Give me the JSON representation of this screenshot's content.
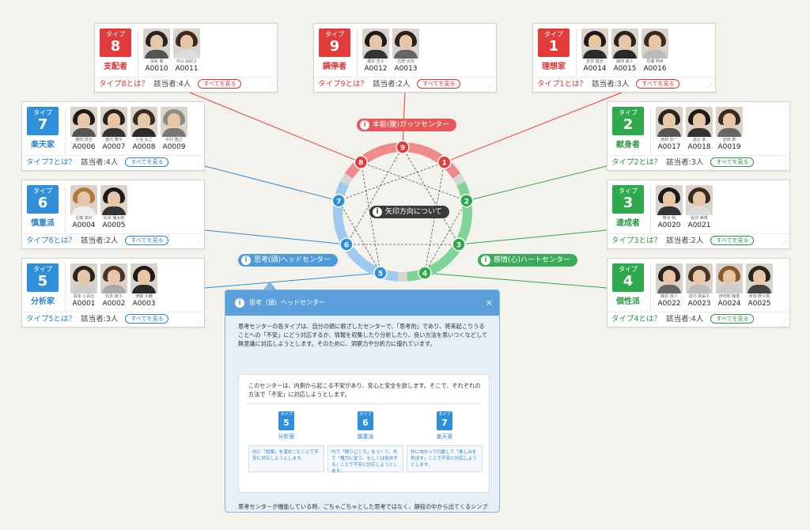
{
  "cards": [
    {
      "id": "t8",
      "type": "タイプ",
      "num": "8",
      "name": "支配者",
      "color": "red",
      "q": "タイプ8とは？",
      "count": "該当者:4人",
      "see": "すべてを見る",
      "members": [
        {
          "name": "深坂 徹",
          "code": "A0010",
          "hair": "#2a2420",
          "shirt": "#555"
        },
        {
          "name": "中山 由紀子",
          "code": "A0011",
          "hair": "#3a2a20",
          "shirt": "#ddd"
        }
      ]
    },
    {
      "id": "t9",
      "type": "タイプ",
      "num": "9",
      "name": "調停者",
      "color": "red",
      "q": "タイプ9とは？",
      "count": "該当者:2人",
      "see": "すべてを見る",
      "members": [
        {
          "name": "橋本 吉子",
          "code": "A0012",
          "hair": "#1e1a18",
          "shirt": "#333"
        },
        {
          "name": "古野 大地",
          "code": "A0013",
          "hair": "#2a221c",
          "shirt": "#666"
        }
      ]
    },
    {
      "id": "t1",
      "type": "タイプ",
      "num": "1",
      "name": "理想家",
      "color": "red",
      "q": "タイプ1とは？",
      "count": "該当者:3人",
      "see": "すべてを見る",
      "members": [
        {
          "name": "岩本 健史",
          "code": "A0014",
          "hair": "#1e1a18",
          "shirt": "#2a2a2a"
        },
        {
          "name": "藤田 夏人",
          "code": "A0015",
          "hair": "#2a221c",
          "shirt": "#2a2a2a"
        },
        {
          "name": "早瀬 明世",
          "code": "A0016",
          "hair": "#3a2a20",
          "shirt": "#bbb"
        }
      ]
    },
    {
      "id": "t7",
      "type": "タイプ",
      "num": "7",
      "name": "楽天家",
      "color": "blue",
      "q": "タイプ7とは？",
      "count": "該当者:4人",
      "see": "すべてを見る",
      "members": [
        {
          "name": "横田 祥正",
          "code": "A0006",
          "hair": "#1e1a18",
          "shirt": "#555"
        },
        {
          "name": "春元 舞平",
          "code": "A0007",
          "hair": "#2a221c",
          "shirt": "#333"
        },
        {
          "name": "小島 弘之",
          "code": "A0008",
          "hair": "#3a2a20",
          "shirt": "#2a2a2a"
        },
        {
          "name": "中村 隆之",
          "code": "A0009",
          "hair": "#8a8a86",
          "shirt": "#777"
        }
      ]
    },
    {
      "id": "t6",
      "type": "タイプ",
      "num": "6",
      "name": "慎重派",
      "color": "blue",
      "q": "タイプ6とは？",
      "count": "該当者:2人",
      "see": "すべてを見る",
      "members": [
        {
          "name": "近藤 真紗",
          "code": "A0004",
          "hair": "#b07a3a",
          "shirt": "#eee"
        },
        {
          "name": "矢澤 優太郎",
          "code": "A0005",
          "hair": "#1e1a18",
          "shirt": "#333"
        }
      ]
    },
    {
      "id": "t5",
      "type": "タイプ",
      "num": "5",
      "name": "分析家",
      "color": "blue",
      "q": "タイプ5とは？",
      "count": "該当者:3人",
      "see": "すべてを見る",
      "members": [
        {
          "name": "岡本 小百合",
          "code": "A0001",
          "hair": "#2a2420",
          "shirt": "#ccc"
        },
        {
          "name": "松本 綾子",
          "code": "A0002",
          "hair": "#4a3424",
          "shirt": "#aaa"
        },
        {
          "name": "伊藤 大輔",
          "code": "A0003",
          "hair": "#1e1a18",
          "shirt": "#2a2a2a"
        }
      ]
    },
    {
      "id": "t2",
      "type": "タイプ",
      "num": "2",
      "name": "献身者",
      "color": "green",
      "q": "タイプ2とは？",
      "count": "該当者:3人",
      "see": "すべてを見る",
      "members": [
        {
          "name": "西林 旧一",
          "code": "A0017",
          "hair": "#2a2420",
          "shirt": "#555"
        },
        {
          "name": "濱辻 孝",
          "code": "A0018",
          "hair": "#1e1a18",
          "shirt": "#333"
        },
        {
          "name": "前田 貫",
          "code": "A0019",
          "hair": "#3a2a20",
          "shirt": "#666"
        }
      ]
    },
    {
      "id": "t3",
      "type": "タイプ",
      "num": "3",
      "name": "達成者",
      "color": "green",
      "q": "タイプ3とは？",
      "count": "該当者:2人",
      "see": "すべてを見る",
      "members": [
        {
          "name": "櫻木 和",
          "code": "A0020",
          "hair": "#1e1a18",
          "shirt": "#333"
        },
        {
          "name": "長井 美菜",
          "code": "A0021",
          "hair": "#3a2a20",
          "shirt": "#ddd"
        }
      ]
    },
    {
      "id": "t4",
      "type": "タイプ",
      "num": "4",
      "name": "個性派",
      "color": "green",
      "q": "タイプ4とは？",
      "count": "該当者:4人",
      "see": "すべてを見る",
      "members": [
        {
          "name": "藤井 良介",
          "code": "A0022",
          "hair": "#2a2420",
          "shirt": "#666"
        },
        {
          "name": "成内 真由子",
          "code": "A0023",
          "hair": "#4a3424",
          "shirt": "#bbb"
        },
        {
          "name": "伊地知 静香",
          "code": "A0024",
          "hair": "#8a5a2a",
          "shirt": "#ccc"
        },
        {
          "name": "世田 野々香",
          "code": "A0025",
          "hair": "#2a2420",
          "shirt": "#444"
        }
      ]
    }
  ],
  "center_labels": {
    "gut": "本能(腹)ガッツセンター",
    "heart": "感情(心)ハートセンター",
    "head": "思考(頭)ヘッドセンター",
    "arrow": "矢印方向について",
    "info_icon": "i"
  },
  "nodes": [
    {
      "num": "9",
      "color": "#e23b3b"
    },
    {
      "num": "1",
      "color": "#e23b3b"
    },
    {
      "num": "2",
      "color": "#2ea94c"
    },
    {
      "num": "3",
      "color": "#2ea94c"
    },
    {
      "num": "4",
      "color": "#2ea94c"
    },
    {
      "num": "5",
      "color": "#2f8fd8"
    },
    {
      "num": "6",
      "color": "#2f8fd8"
    },
    {
      "num": "7",
      "color": "#2f8fd8"
    },
    {
      "num": "8",
      "color": "#e23b3b"
    }
  ],
  "colors": {
    "red": "#e23b3b",
    "blue": "#2f8fd8",
    "green": "#2ea94c",
    "ring_grey": "#d8d6d1",
    "ring_red": "#f08a8a",
    "ring_green": "#7fd49a",
    "ring_blue": "#9fcaf0"
  },
  "popup": {
    "title": "思考（頭）ヘッドセンター",
    "close": "×",
    "text1": "思考センターの各タイプは、自分の頭に根ざしたセンターで、「思考的」であり、将来起こりうることへの「不安」にどう対応するか、情報を収集したり分析したり、良い方法を思いつくなどして無意識に対応しようとします。そのために、洞察力や分析力に優れています。",
    "text2": "このセンターは、内側から起こる不安があり、安心と安全を欲します。そこで、それぞれの方法で「不安」に対応しようとします。",
    "subs": [
      {
        "type": "タイプ",
        "num": "5",
        "name": "分析家",
        "desc": "内に「知識」を溜めこむことで不安に対応しようとします。"
      },
      {
        "type": "タイプ",
        "num": "6",
        "name": "慎重派",
        "desc": "内で「拠りどころ」をつくり、外で「権力に従う、もしくは抵抗する」ことで不安に対応しようとします。"
      },
      {
        "type": "タイプ",
        "num": "7",
        "name": "楽天家",
        "desc": "外に向かって行動して「楽しみを見出す」ことで不安に対応しようとします。"
      }
    ],
    "text3": "思考センターが機能している時、ごちゃごちゃとした思考ではなく、静寂の中から出てくるシンプルで本質的なインスピレーションを感じます。一方、うまく機能していないときは、複雑な思考の渦に巻き込まれて不安を感じます。"
  }
}
